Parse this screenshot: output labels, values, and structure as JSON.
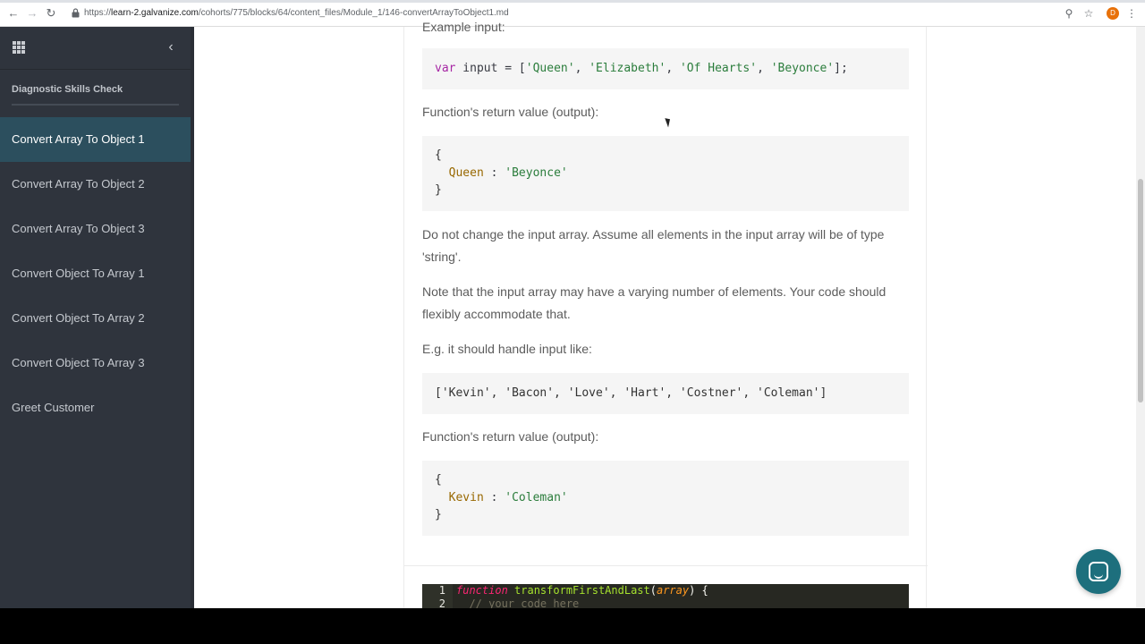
{
  "browser": {
    "url_prefix": "https://",
    "url_host": "learn-2.galvanize.com",
    "url_path": "/cohorts/775/blocks/64/content_files/Module_1/146-convertArrayToObject1.md",
    "avatar_letter": "D"
  },
  "sidebar": {
    "section_title": "Diagnostic Skills Check",
    "items": [
      {
        "label": "Convert Array To Object 1"
      },
      {
        "label": "Convert Array To Object 2"
      },
      {
        "label": "Convert Array To Object 3"
      },
      {
        "label": "Convert Object To Array 1"
      },
      {
        "label": "Convert Object To Array 2"
      },
      {
        "label": "Convert Object To Array 3"
      },
      {
        "label": "Greet Customer"
      }
    ]
  },
  "content": {
    "example_input_label": "Example input:",
    "code1": {
      "kw": "var",
      "rest": " input = [",
      "s1": "'Queen'",
      "s2": "'Elizabeth'",
      "s3": "'Of Hearts'",
      "s4": "'Beyonce'",
      "end": "];"
    },
    "return_label_1": "Function's return value (output):",
    "code2": {
      "open": "{",
      "key": "Queen",
      "sep": " : ",
      "val": "'Beyonce'",
      "close": "}"
    },
    "para1": "Do not change the input array. Assume all elements in the input array will be of type 'string'.",
    "para2": "Note that the input array may have a varying number of elements. Your code should flexibly accommodate that.",
    "para3": "E.g. it should handle input like:",
    "code3": "['Kevin', 'Bacon', 'Love', 'Hart', 'Costner', 'Coleman']",
    "return_label_2": "Function's return value (output):",
    "code4": {
      "open": "{",
      "key": "Kevin",
      "sep": " : ",
      "val": "'Coleman'",
      "close": "}"
    }
  },
  "editor": {
    "line1_num": "1",
    "line2_num": "2",
    "line1": {
      "kw": "function",
      "name": " transformFirstAndLast",
      "open": "(",
      "param": "array",
      "close": ") {"
    },
    "line2": "  // your code here"
  }
}
